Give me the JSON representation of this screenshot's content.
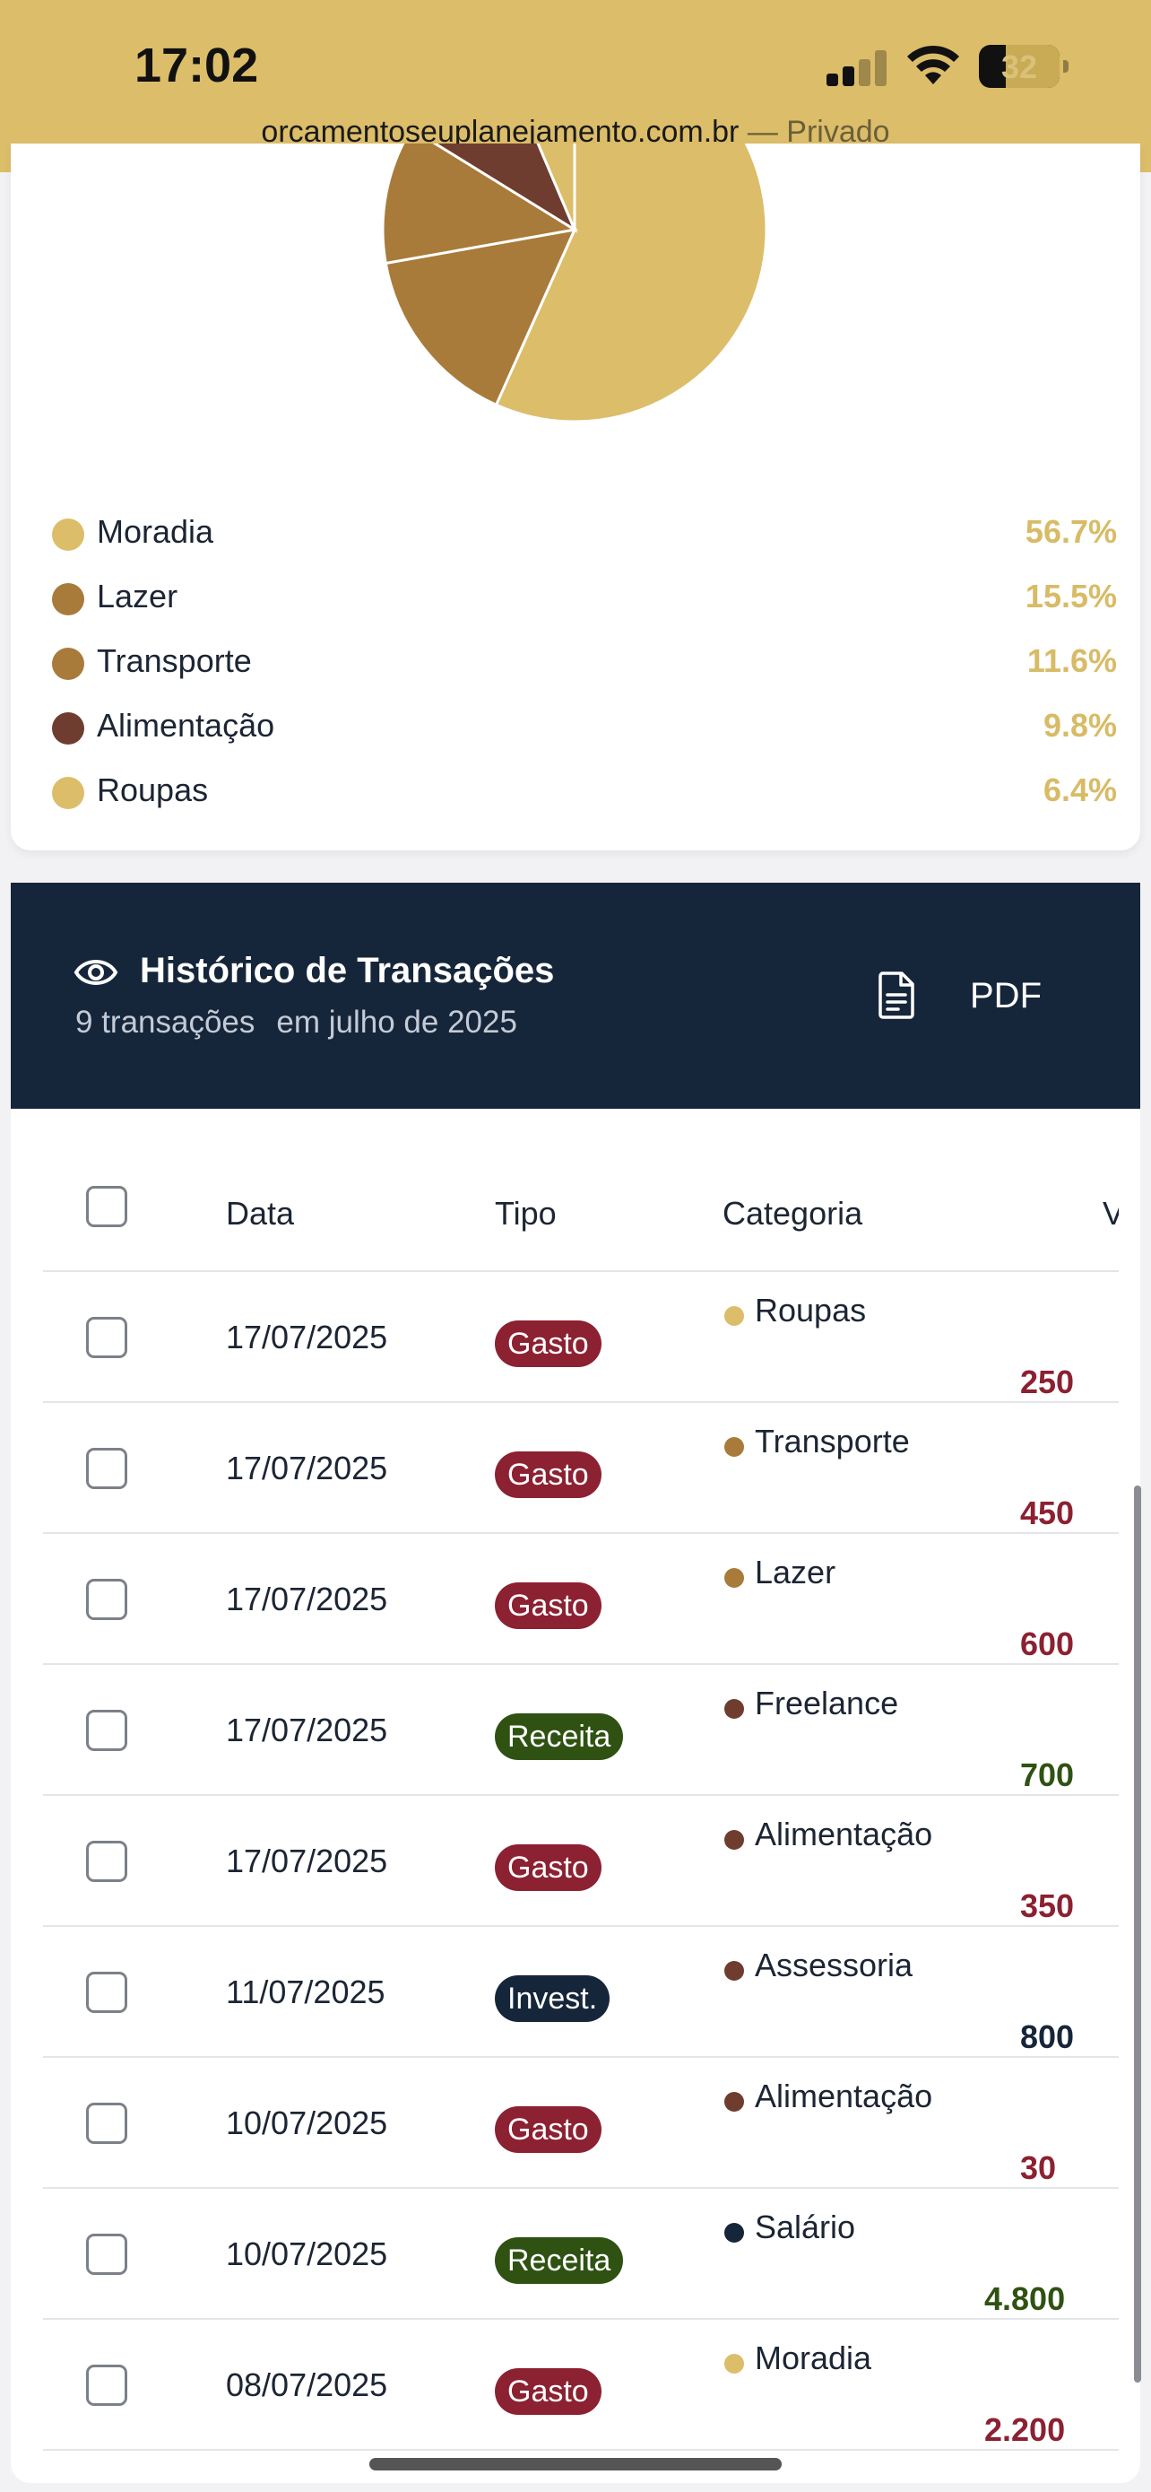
{
  "status_bar": {
    "time": "17:02",
    "battery": "32",
    "url": "orcamentoseuplanejamento.com.br",
    "mode": "— Privado"
  },
  "colors": {
    "gold": "#dcbd69",
    "navy": "#16263a",
    "expense_red": "#8b2131",
    "income_green": "#2f5213",
    "invest_navy": "#16263a"
  },
  "chart_data": {
    "type": "pie",
    "title": "",
    "slices": [
      {
        "label": "Moradia",
        "percent": 56.7,
        "color": "#dcbd69"
      },
      {
        "label": "Lazer",
        "percent": 15.5,
        "color": "#a87b3b"
      },
      {
        "label": "Transporte",
        "percent": 11.6,
        "color": "#a87b3b"
      },
      {
        "label": "Alimentação",
        "percent": 9.8,
        "color": "#6e3d2f"
      },
      {
        "label": "Roupas",
        "percent": 6.4,
        "color": "#dcbd69"
      }
    ]
  },
  "legend": [
    {
      "label": "Moradia",
      "pct": "56.7%",
      "color": "#dcbd69"
    },
    {
      "label": "Lazer",
      "pct": "15.5%",
      "color": "#a87b3b"
    },
    {
      "label": "Transporte",
      "pct": "11.6%",
      "color": "#a87b3b"
    },
    {
      "label": "Alimentação",
      "pct": "9.8%",
      "color": "#6e3d2f"
    },
    {
      "label": "Roupas",
      "pct": "6.4%",
      "color": "#dcbd69"
    }
  ],
  "history": {
    "title": "Histórico de Transações",
    "count": "9 transações",
    "period": "em julho de 2025",
    "pdf_label": "PDF",
    "columns": {
      "date": "Data",
      "type": "Tipo",
      "category": "Categoria",
      "value": "V"
    },
    "rows": [
      {
        "date": "17/07/2025",
        "type": "Gasto",
        "category": "Roupas",
        "cat_color": "#dcbd69",
        "value": "250",
        "kind": "expense"
      },
      {
        "date": "17/07/2025",
        "type": "Gasto",
        "category": "Transporte",
        "cat_color": "#a87b3b",
        "value": "450",
        "kind": "expense"
      },
      {
        "date": "17/07/2025",
        "type": "Gasto",
        "category": "Lazer",
        "cat_color": "#a87b3b",
        "value": "600",
        "kind": "expense"
      },
      {
        "date": "17/07/2025",
        "type": "Receita",
        "category": "Freelance",
        "cat_color": "#6e3d2f",
        "value": "700",
        "kind": "income"
      },
      {
        "date": "17/07/2025",
        "type": "Gasto",
        "category": "Alimentação",
        "cat_color": "#6e3d2f",
        "value": "350",
        "kind": "expense"
      },
      {
        "date": "11/07/2025",
        "type": "Invest.",
        "category": "Assessoria",
        "cat_color": "#6e3d2f",
        "value": "800",
        "kind": "invest"
      },
      {
        "date": "10/07/2025",
        "type": "Gasto",
        "category": "Alimentação",
        "cat_color": "#6e3d2f",
        "value": "30",
        "kind": "expense"
      },
      {
        "date": "10/07/2025",
        "type": "Receita",
        "category": "Salário",
        "cat_color": "#16263a",
        "value": "4.800",
        "kind": "income"
      },
      {
        "date": "08/07/2025",
        "type": "Gasto",
        "category": "Moradia",
        "cat_color": "#dcbd69",
        "value": "2.200",
        "kind": "expense"
      }
    ]
  }
}
